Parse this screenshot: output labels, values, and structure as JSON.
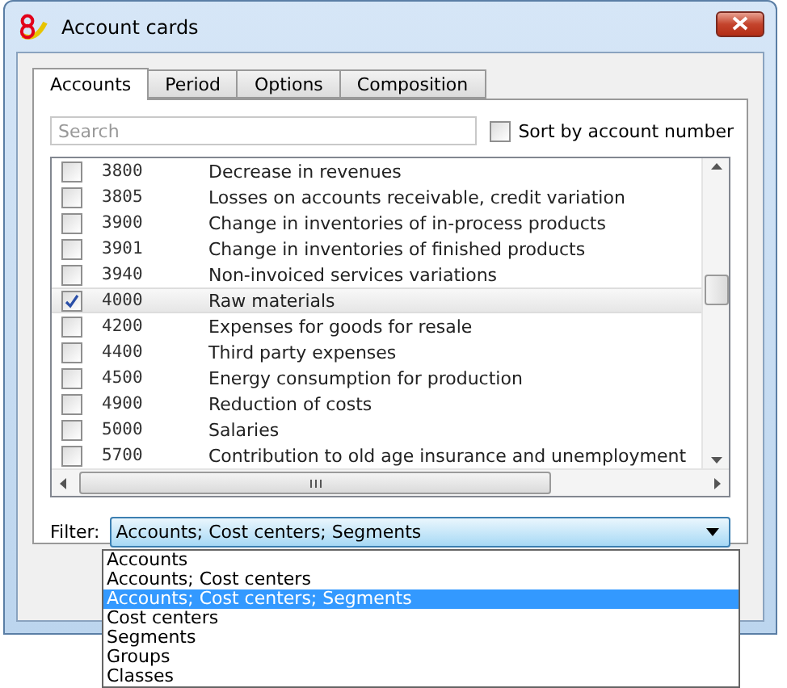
{
  "window": {
    "title": "Account cards"
  },
  "tabs": [
    {
      "label": "Accounts",
      "selected": true
    },
    {
      "label": "Period",
      "selected": false
    },
    {
      "label": "Options",
      "selected": false
    },
    {
      "label": "Composition",
      "selected": false
    }
  ],
  "search": {
    "placeholder": "Search"
  },
  "sort_by_number": {
    "label": "Sort by account number",
    "checked": false
  },
  "accounts": [
    {
      "number": "3800",
      "name": "Decrease in revenues",
      "checked": false,
      "selected": false
    },
    {
      "number": "3805",
      "name": "Losses on accounts receivable, credit variation",
      "checked": false,
      "selected": false
    },
    {
      "number": "3900",
      "name": "Change in inventories of in-process products",
      "checked": false,
      "selected": false
    },
    {
      "number": "3901",
      "name": "Change in inventories of finished products",
      "checked": false,
      "selected": false
    },
    {
      "number": "3940",
      "name": "Non-invoiced services variations",
      "checked": false,
      "selected": false
    },
    {
      "number": "4000",
      "name": "Raw materials",
      "checked": true,
      "selected": true
    },
    {
      "number": "4200",
      "name": "Expenses for goods for resale",
      "checked": false,
      "selected": false
    },
    {
      "number": "4400",
      "name": "Third party expenses",
      "checked": false,
      "selected": false
    },
    {
      "number": "4500",
      "name": "Energy consumption for production",
      "checked": false,
      "selected": false
    },
    {
      "number": "4900",
      "name": "Reduction of costs",
      "checked": false,
      "selected": false
    },
    {
      "number": "5000",
      "name": "Salaries",
      "checked": false,
      "selected": false
    },
    {
      "number": "5700",
      "name": "Contribution to old age insurance and unemployment",
      "checked": false,
      "selected": false
    }
  ],
  "filter": {
    "label": "Filter:",
    "value": "Accounts; Cost centers; Segments",
    "expanded": true,
    "options": [
      {
        "label": "Accounts",
        "selected": false
      },
      {
        "label": "Accounts; Cost centers",
        "selected": false
      },
      {
        "label": "Accounts; Cost centers; Segments",
        "selected": true
      },
      {
        "label": "Cost centers",
        "selected": false
      },
      {
        "label": "Segments",
        "selected": false
      },
      {
        "label": "Groups",
        "selected": false
      },
      {
        "label": "Classes",
        "selected": false
      }
    ]
  }
}
